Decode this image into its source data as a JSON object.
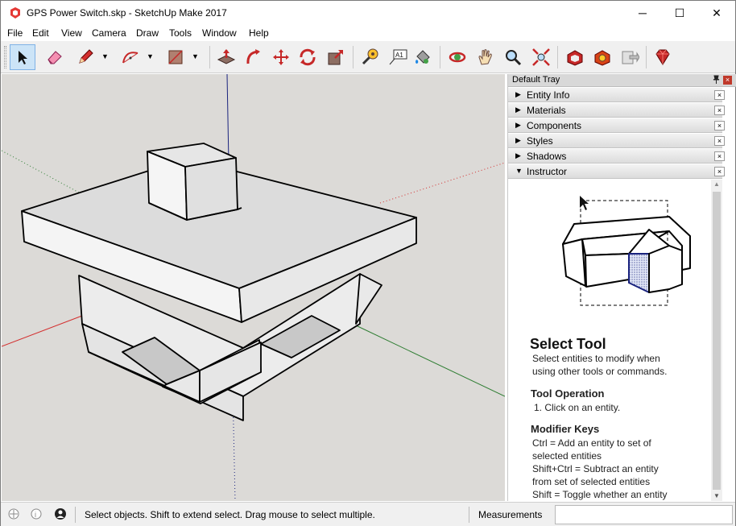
{
  "window": {
    "title": "GPS Power Switch.skp - SketchUp Make 2017",
    "minimize": "─",
    "maximize": "☐",
    "close": "✕"
  },
  "menu": [
    "File",
    "Edit",
    "View",
    "Camera",
    "Draw",
    "Tools",
    "Window",
    "Help"
  ],
  "toolbar": {
    "tools": [
      "select-tool",
      "eraser-tool",
      "pencil-tool",
      "arc-tool",
      "rectangle-tool",
      "push-pull-tool",
      "follow-me-tool",
      "move-tool",
      "rotate-tool",
      "scale-tool",
      "tape-measure-tool",
      "text-tool",
      "paint-bucket-tool",
      "orbit-tool",
      "pan-tool",
      "zoom-tool",
      "zoom-extents-tool",
      "3d-warehouse",
      "extension-warehouse",
      "send-to-layout",
      "ruby-extension"
    ],
    "text_tool_label": "A1",
    "dropdown_glyph": "▼"
  },
  "tray": {
    "title": "Default Tray",
    "pin_glyph": "📌",
    "close_glyph": "×",
    "panels": [
      {
        "label": "Entity Info",
        "arrow": "▶"
      },
      {
        "label": "Materials",
        "arrow": "▶"
      },
      {
        "label": "Components",
        "arrow": "▶"
      },
      {
        "label": "Styles",
        "arrow": "▶"
      },
      {
        "label": "Shadows",
        "arrow": "▶"
      },
      {
        "label": "Instructor",
        "arrow": "▼"
      }
    ],
    "panel_close": "×"
  },
  "instructor": {
    "title": "Select Tool",
    "description": "Select entities to modify when using other tools or commands.",
    "operation_heading": "Tool Operation",
    "operation_step": "1. Click on an entity.",
    "modifier_heading": "Modifier Keys",
    "modifier_lines": [
      "Ctrl = Add an entity to set of selected entities",
      "Shift+Ctrl = Subtract an entity from set of selected entities",
      "Shift = Toggle whether an entity"
    ]
  },
  "status": {
    "message": "Select objects. Shift to extend select. Drag mouse to select multiple.",
    "measurements_label": "Measurements",
    "measurements_value": ""
  },
  "colors": {
    "x_axis": "#d32f2f",
    "y_axis": "#2e7d32",
    "z_axis": "#1a237e",
    "viewport_bg": "#dcdad7",
    "selection_highlight": "#cce4f7"
  }
}
